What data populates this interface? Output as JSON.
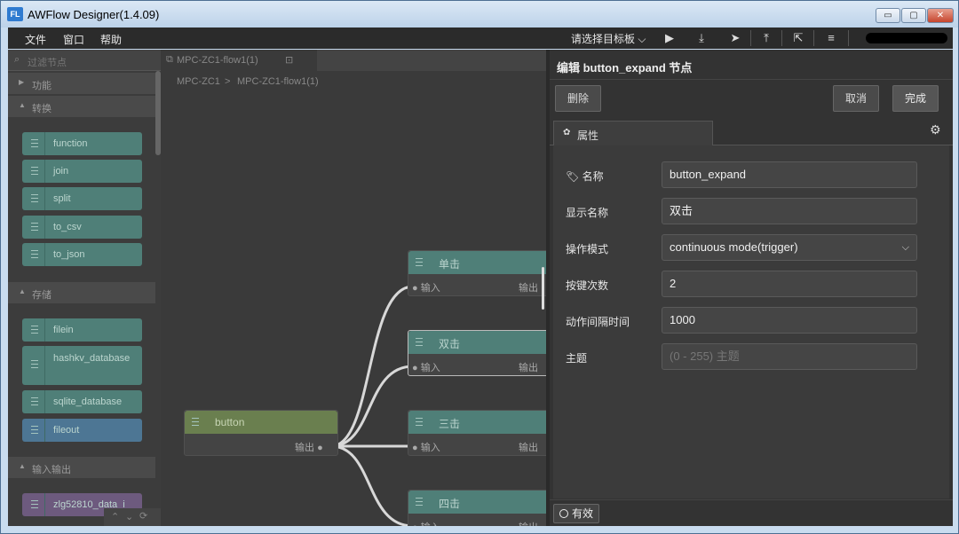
{
  "window": {
    "logo": "FL",
    "title": "AWFlow Designer(1.4.09)",
    "controls": {
      "minimize": "▭",
      "maximize": "▢",
      "close": "✕"
    }
  },
  "menubar": {
    "items": [
      "文件",
      "窗口",
      "帮助"
    ],
    "target_select": "请选择目标板 ⌵",
    "tools": [
      "play-icon",
      "download-icon",
      "send-icon",
      "upload-icon",
      "export-icon",
      "server-icon"
    ]
  },
  "palette": {
    "search_placeholder": "过滤节点",
    "categories": {
      "function_cat": "功能",
      "convert": "转换",
      "storage": "存储",
      "io": "输入输出"
    },
    "convert_nodes": [
      "function",
      "join",
      "split",
      "to_csv",
      "to_json"
    ],
    "storage_nodes": [
      "filein",
      "hashkv_database",
      "sqlite_database",
      "fileout"
    ],
    "io_nodes": [
      "zlg52810_data_i"
    ],
    "footer": {
      "up": "⌃",
      "down": "⌄",
      "refresh": "⟳"
    }
  },
  "workspace": {
    "tab_label": "MPC-ZC1-flow1(1)",
    "breadcrumb": [
      "MPC-ZC1",
      ">",
      "MPC-ZC1-flow1(1)"
    ],
    "nodes": [
      {
        "label": "单击",
        "in": "输入",
        "out": "输出"
      },
      {
        "label": "双击",
        "in": "输入",
        "out": "输出"
      },
      {
        "label": "三击",
        "in": "输入",
        "out": "输出"
      },
      {
        "label": "四击",
        "in": "输入",
        "out": "输出"
      }
    ],
    "source_node": {
      "label": "button",
      "out": "输出"
    }
  },
  "editor": {
    "title": "编辑 button_expand 节点",
    "delete_label": "删除",
    "cancel_label": "取消",
    "done_label": "完成",
    "tab_label": "属性",
    "fields": {
      "name": {
        "label": "名称",
        "value": "button_expand"
      },
      "display_name": {
        "label": "显示名称",
        "value": "双击"
      },
      "mode": {
        "label": "操作模式",
        "value": "continuous mode(trigger)"
      },
      "key_count": {
        "label": "按键次数",
        "value": "2"
      },
      "interval": {
        "label": "动作间隔时间",
        "value": "1000"
      },
      "topic": {
        "label": "主题",
        "placeholder": "(0 - 255) 主题"
      }
    },
    "enable_label": "有效"
  }
}
